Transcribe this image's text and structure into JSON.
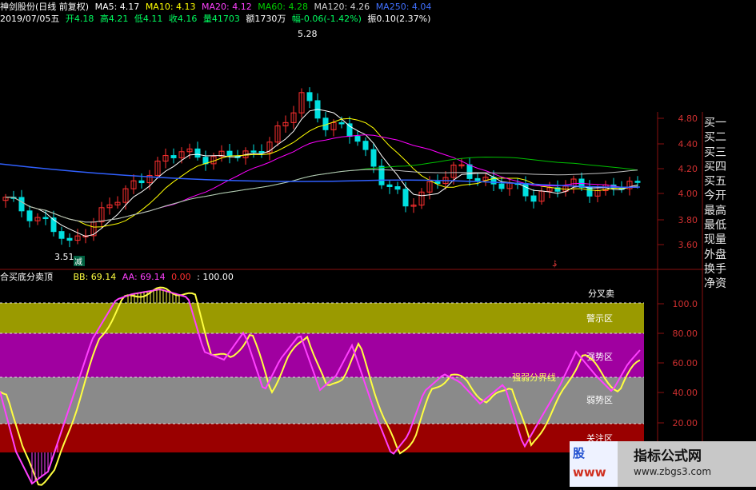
{
  "top_bar": {
    "stock": "神剑股份(日线 前复权)",
    "ma5": "MA5: 4.17",
    "ma10": "MA10: 4.13",
    "ma20": "MA20: 4.12",
    "ma60": "MA60: 4.28",
    "ma120": "MA120: 4.26",
    "ma250": "MA250: 4.04"
  },
  "info_bar": {
    "date": "2019/07/05五",
    "open": "开4.18",
    "high": "高4.21",
    "low": "低4.11",
    "close": "收4.16",
    "volume": "量41703",
    "amount": "额1730万",
    "change": "幅-0.06(-1.42%)",
    "amplitude": "振0.10(2.37%)"
  },
  "price_annotations": {
    "high": "5.28",
    "low": "3.51",
    "marker": "减",
    "marker2": "$"
  },
  "price_axis": [
    "4.80",
    "4.40",
    "4.20",
    "4.00",
    "3.80",
    "3.60"
  ],
  "side_menu": [
    "买一",
    "买二",
    "买三",
    "买四",
    "买五",
    "今开",
    "最高",
    "最低",
    "现量",
    "外盘",
    "换手",
    "净资"
  ],
  "indicator_bar": {
    "name": "合买底分卖顶",
    "bb": "BB: 69.14",
    "aa": "AA: 69.14",
    "v1": "0.00",
    "v2": ": 100.00"
  },
  "zones": {
    "sell": "分叉卖",
    "warn": "警示区",
    "strong": "强势区",
    "boundary": "强弱分界线",
    "weak": "弱势区",
    "bottom": "关注区"
  },
  "indicator_axis": [
    "100.0",
    "80.00",
    "60.00",
    "40.00",
    "20.00"
  ],
  "watermark": {
    "left_top": "股",
    "left_bottom": "www",
    "title": "指标公式网",
    "url": "www.zbgs3.com"
  },
  "colors": {
    "up": "#ff3030",
    "down": "#00e0e0",
    "ma5": "#ffffff",
    "ma10": "#ffff00",
    "ma20": "#ff00ff",
    "ma60": "#00c000",
    "ma120": "#c0c0c0",
    "ma250": "#3060ff",
    "aa": "#ff40ff",
    "bb": "#ffff40"
  }
}
